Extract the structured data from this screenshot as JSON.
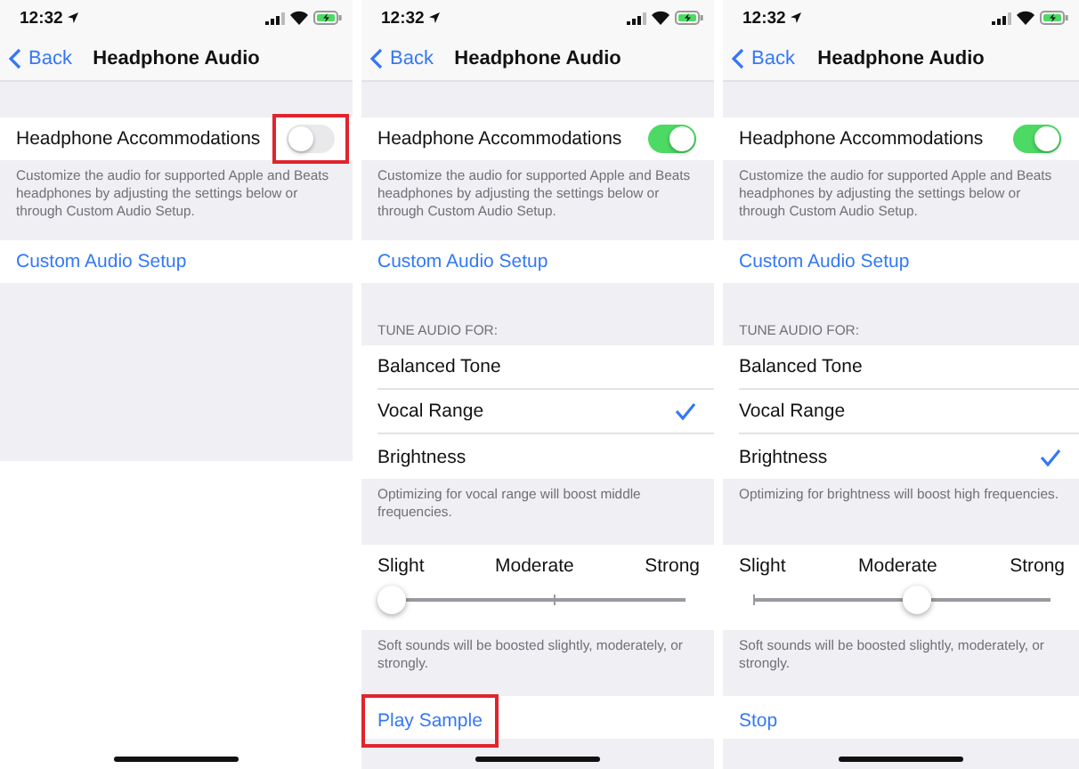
{
  "screens": [
    {
      "status_bar": {
        "time": "12:32"
      },
      "nav": {
        "back": "Back",
        "title": "Headphone Audio"
      },
      "accommodations": {
        "label": "Headphone Accommodations",
        "on": false,
        "highlighted": true
      },
      "description": "Customize the audio for supported Apple and Beats headphones by adjusting the settings below or through Custom Audio Setup.",
      "custom_setup": {
        "label": "Custom Audio Setup"
      }
    },
    {
      "status_bar": {
        "time": "12:32"
      },
      "nav": {
        "back": "Back",
        "title": "Headphone Audio"
      },
      "accommodations": {
        "label": "Headphone Accommodations",
        "on": true,
        "highlighted": false
      },
      "description": "Customize the audio for supported Apple and Beats headphones by adjusting the settings below or through Custom Audio Setup.",
      "custom_setup": {
        "label": "Custom Audio Setup"
      },
      "tune": {
        "header": "TUNE AUDIO FOR:",
        "options": [
          {
            "label": "Balanced Tone",
            "selected": false
          },
          {
            "label": "Vocal Range",
            "selected": true
          },
          {
            "label": "Brightness",
            "selected": false
          }
        ],
        "description": "Optimizing for vocal range will boost middle frequencies.",
        "slider": {
          "labels": [
            "Slight",
            "Moderate",
            "Strong"
          ],
          "level": 0
        },
        "slider_description": "Soft sounds will be boosted slightly, moderately, or strongly.",
        "action": {
          "label": "Play Sample",
          "highlighted": true
        }
      }
    },
    {
      "status_bar": {
        "time": "12:32"
      },
      "nav": {
        "back": "Back",
        "title": "Headphone Audio"
      },
      "accommodations": {
        "label": "Headphone Accommodations",
        "on": true,
        "highlighted": false
      },
      "description": "Customize the audio for supported Apple and Beats headphones by adjusting the settings below or through Custom Audio Setup.",
      "custom_setup": {
        "label": "Custom Audio Setup"
      },
      "tune": {
        "header": "TUNE AUDIO FOR:",
        "options": [
          {
            "label": "Balanced Tone",
            "selected": false
          },
          {
            "label": "Vocal Range",
            "selected": false
          },
          {
            "label": "Brightness",
            "selected": true
          }
        ],
        "description": "Optimizing for brightness will boost high frequencies.",
        "slider": {
          "labels": [
            "Slight",
            "Moderate",
            "Strong"
          ],
          "level": 0.5
        },
        "slider_description": "Soft sounds will be boosted slightly, moderately, or strongly.",
        "action": {
          "label": "Stop",
          "highlighted": false
        }
      }
    }
  ]
}
